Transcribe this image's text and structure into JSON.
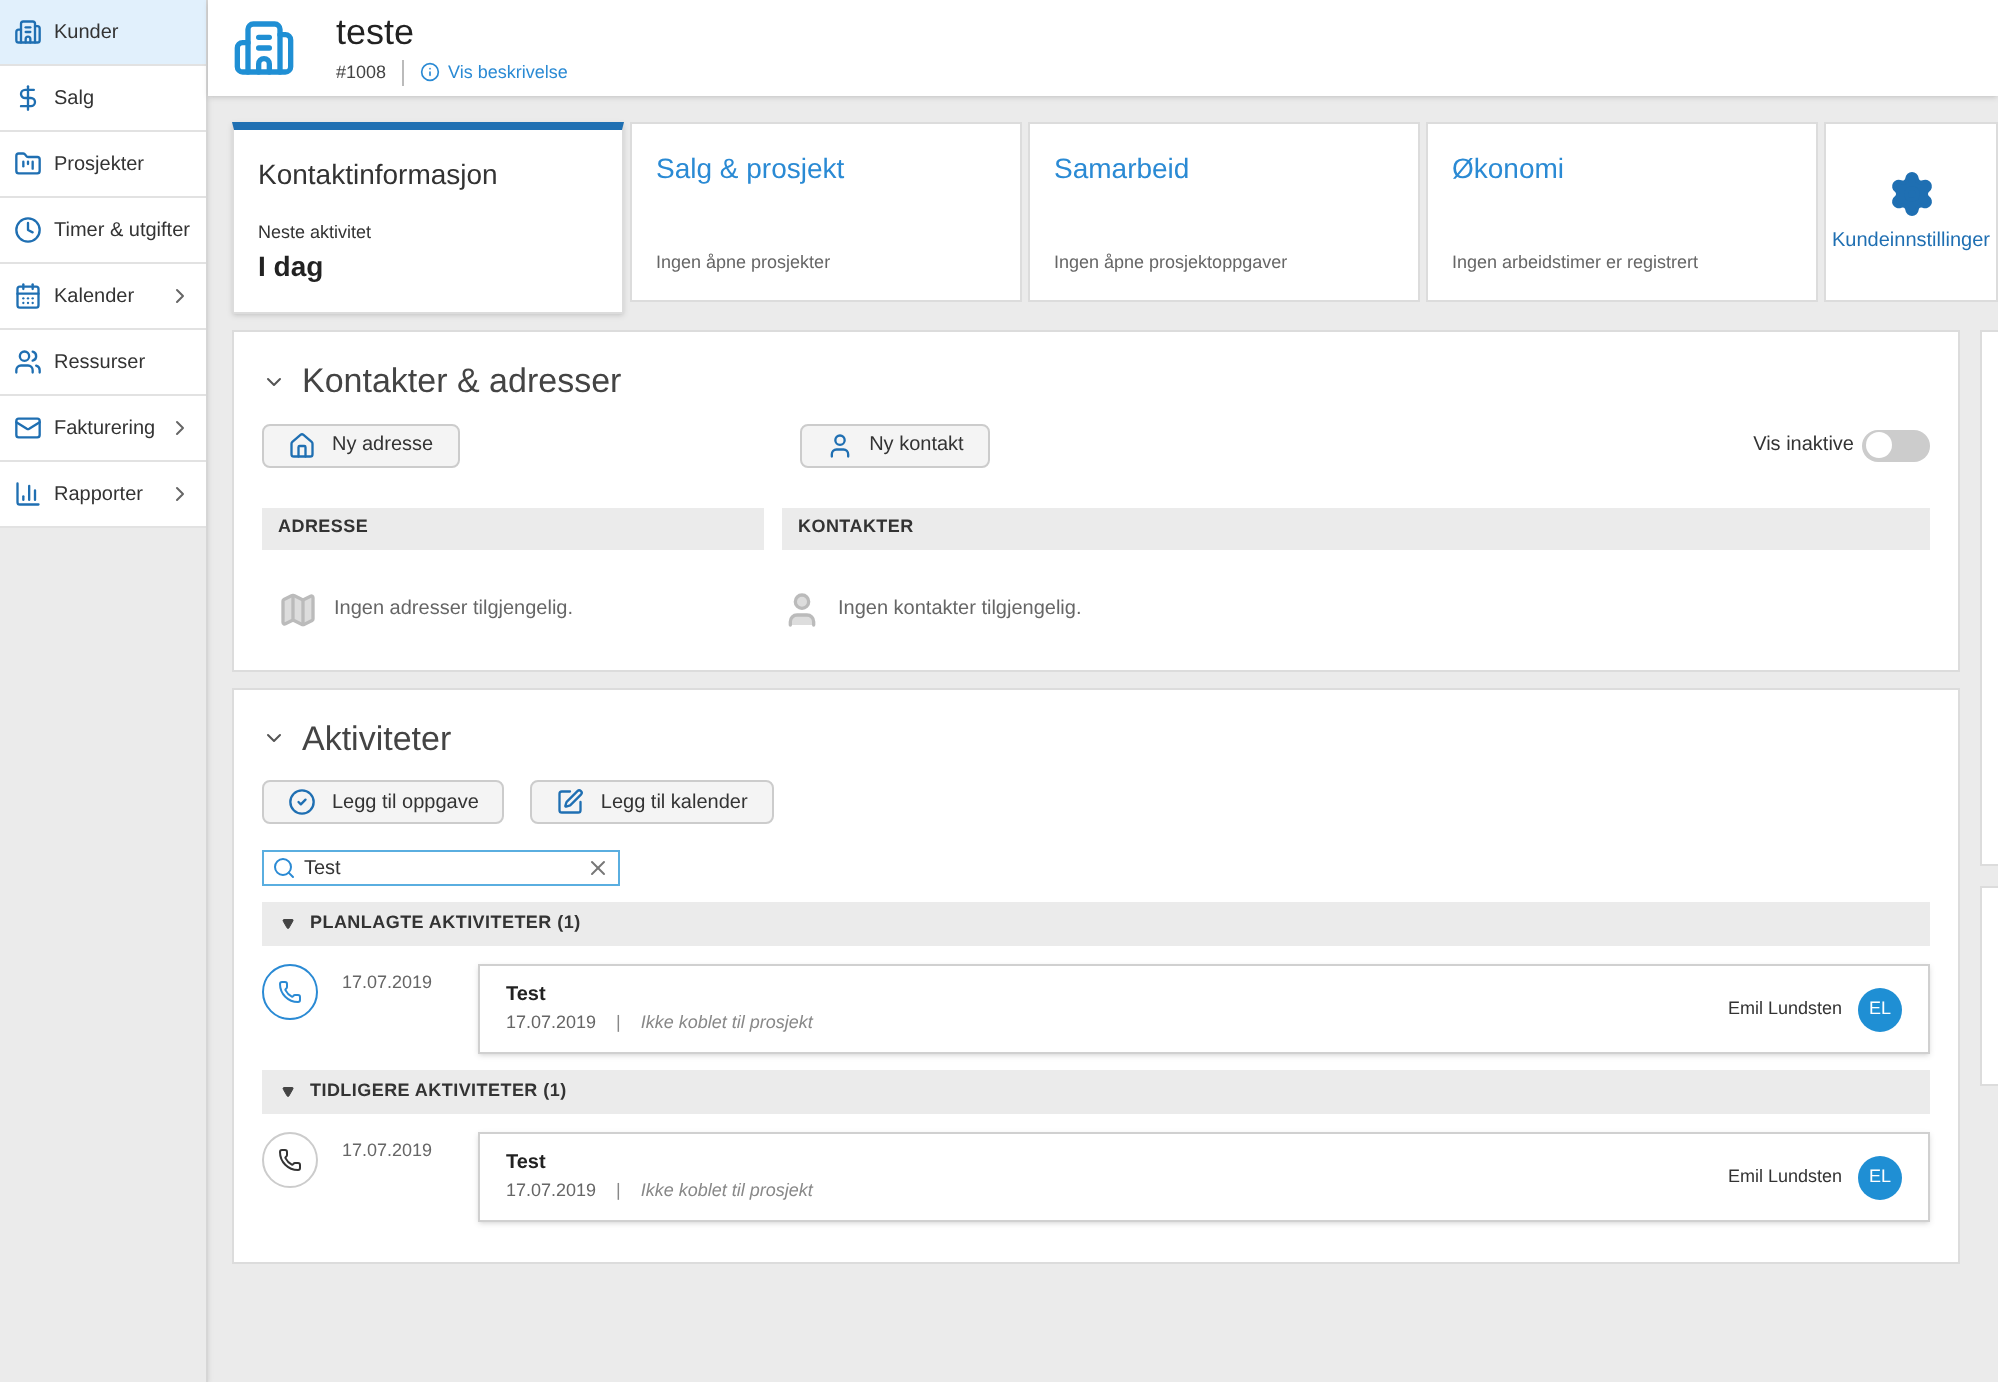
{
  "sidebar": {
    "items": [
      {
        "label": "Kunder",
        "selected": true,
        "submenu": false
      },
      {
        "label": "Salg",
        "selected": false,
        "submenu": false
      },
      {
        "label": "Prosjekter",
        "selected": false,
        "submenu": false
      },
      {
        "label": "Timer & utgifter",
        "selected": false,
        "submenu": false
      },
      {
        "label": "Kalender",
        "selected": false,
        "submenu": true
      },
      {
        "label": "Ressurser",
        "selected": false,
        "submenu": false
      },
      {
        "label": "Fakturering",
        "selected": false,
        "submenu": true
      },
      {
        "label": "Rapporter",
        "selected": false,
        "submenu": true
      }
    ]
  },
  "header": {
    "title": "teste",
    "number": "#1008",
    "description_link": "Vis beskrivelse"
  },
  "tabs": [
    {
      "kind": "info",
      "title": "Kontaktinformasjon",
      "caption": "Neste aktivitet",
      "value": "I dag",
      "selected": true
    },
    {
      "kind": "summary",
      "title": "Salg & prosjekt",
      "caption": "Ingen åpne prosjekter",
      "selected": false
    },
    {
      "kind": "summary",
      "title": "Samarbeid",
      "caption": "Ingen åpne prosjektoppgaver",
      "selected": false
    },
    {
      "kind": "summary",
      "title": "Økonomi",
      "caption": "Ingen arbeidstimer er registrert",
      "selected": false
    },
    {
      "kind": "settings",
      "title": "Kundeinnstillinger",
      "selected": false
    }
  ],
  "contacts_section": {
    "title": "Kontakter & adresser",
    "expanded": true,
    "add_address": "Ny adresse",
    "add_contact": "Ny kontakt",
    "toggle_label": "Vis inaktive",
    "toggle_on": false,
    "address_header": "ADRESSE",
    "contacts_header": "KONTAKTER",
    "address_empty": "Ingen adresser tilgjengelig.",
    "contacts_empty": "Ingen kontakter tilgjengelig."
  },
  "activities_section": {
    "title": "Aktiviteter",
    "expanded": true,
    "add_task": "Legg til oppgave",
    "add_calendar": "Legg til kalender",
    "search_value": "Test",
    "groups": [
      {
        "title": "PLANLAGTE AKTIVITETER (1)",
        "expanded": true,
        "upcoming": true,
        "items": [
          {
            "date": "17.07.2019",
            "title": "Test",
            "sub_date": "17.07.2019",
            "separator": "|",
            "project": "Ikke koblet til prosjekt",
            "owner": "Emil Lundsten",
            "initials": "EL"
          }
        ]
      },
      {
        "title": "TIDLIGERE AKTIVITETER (1)",
        "expanded": true,
        "upcoming": false,
        "items": [
          {
            "date": "17.07.2019",
            "title": "Test",
            "sub_date": "17.07.2019",
            "separator": "|",
            "project": "Ikke koblet til prosjekt",
            "owner": "Emil Lundsten",
            "initials": "EL"
          }
        ]
      }
    ]
  }
}
